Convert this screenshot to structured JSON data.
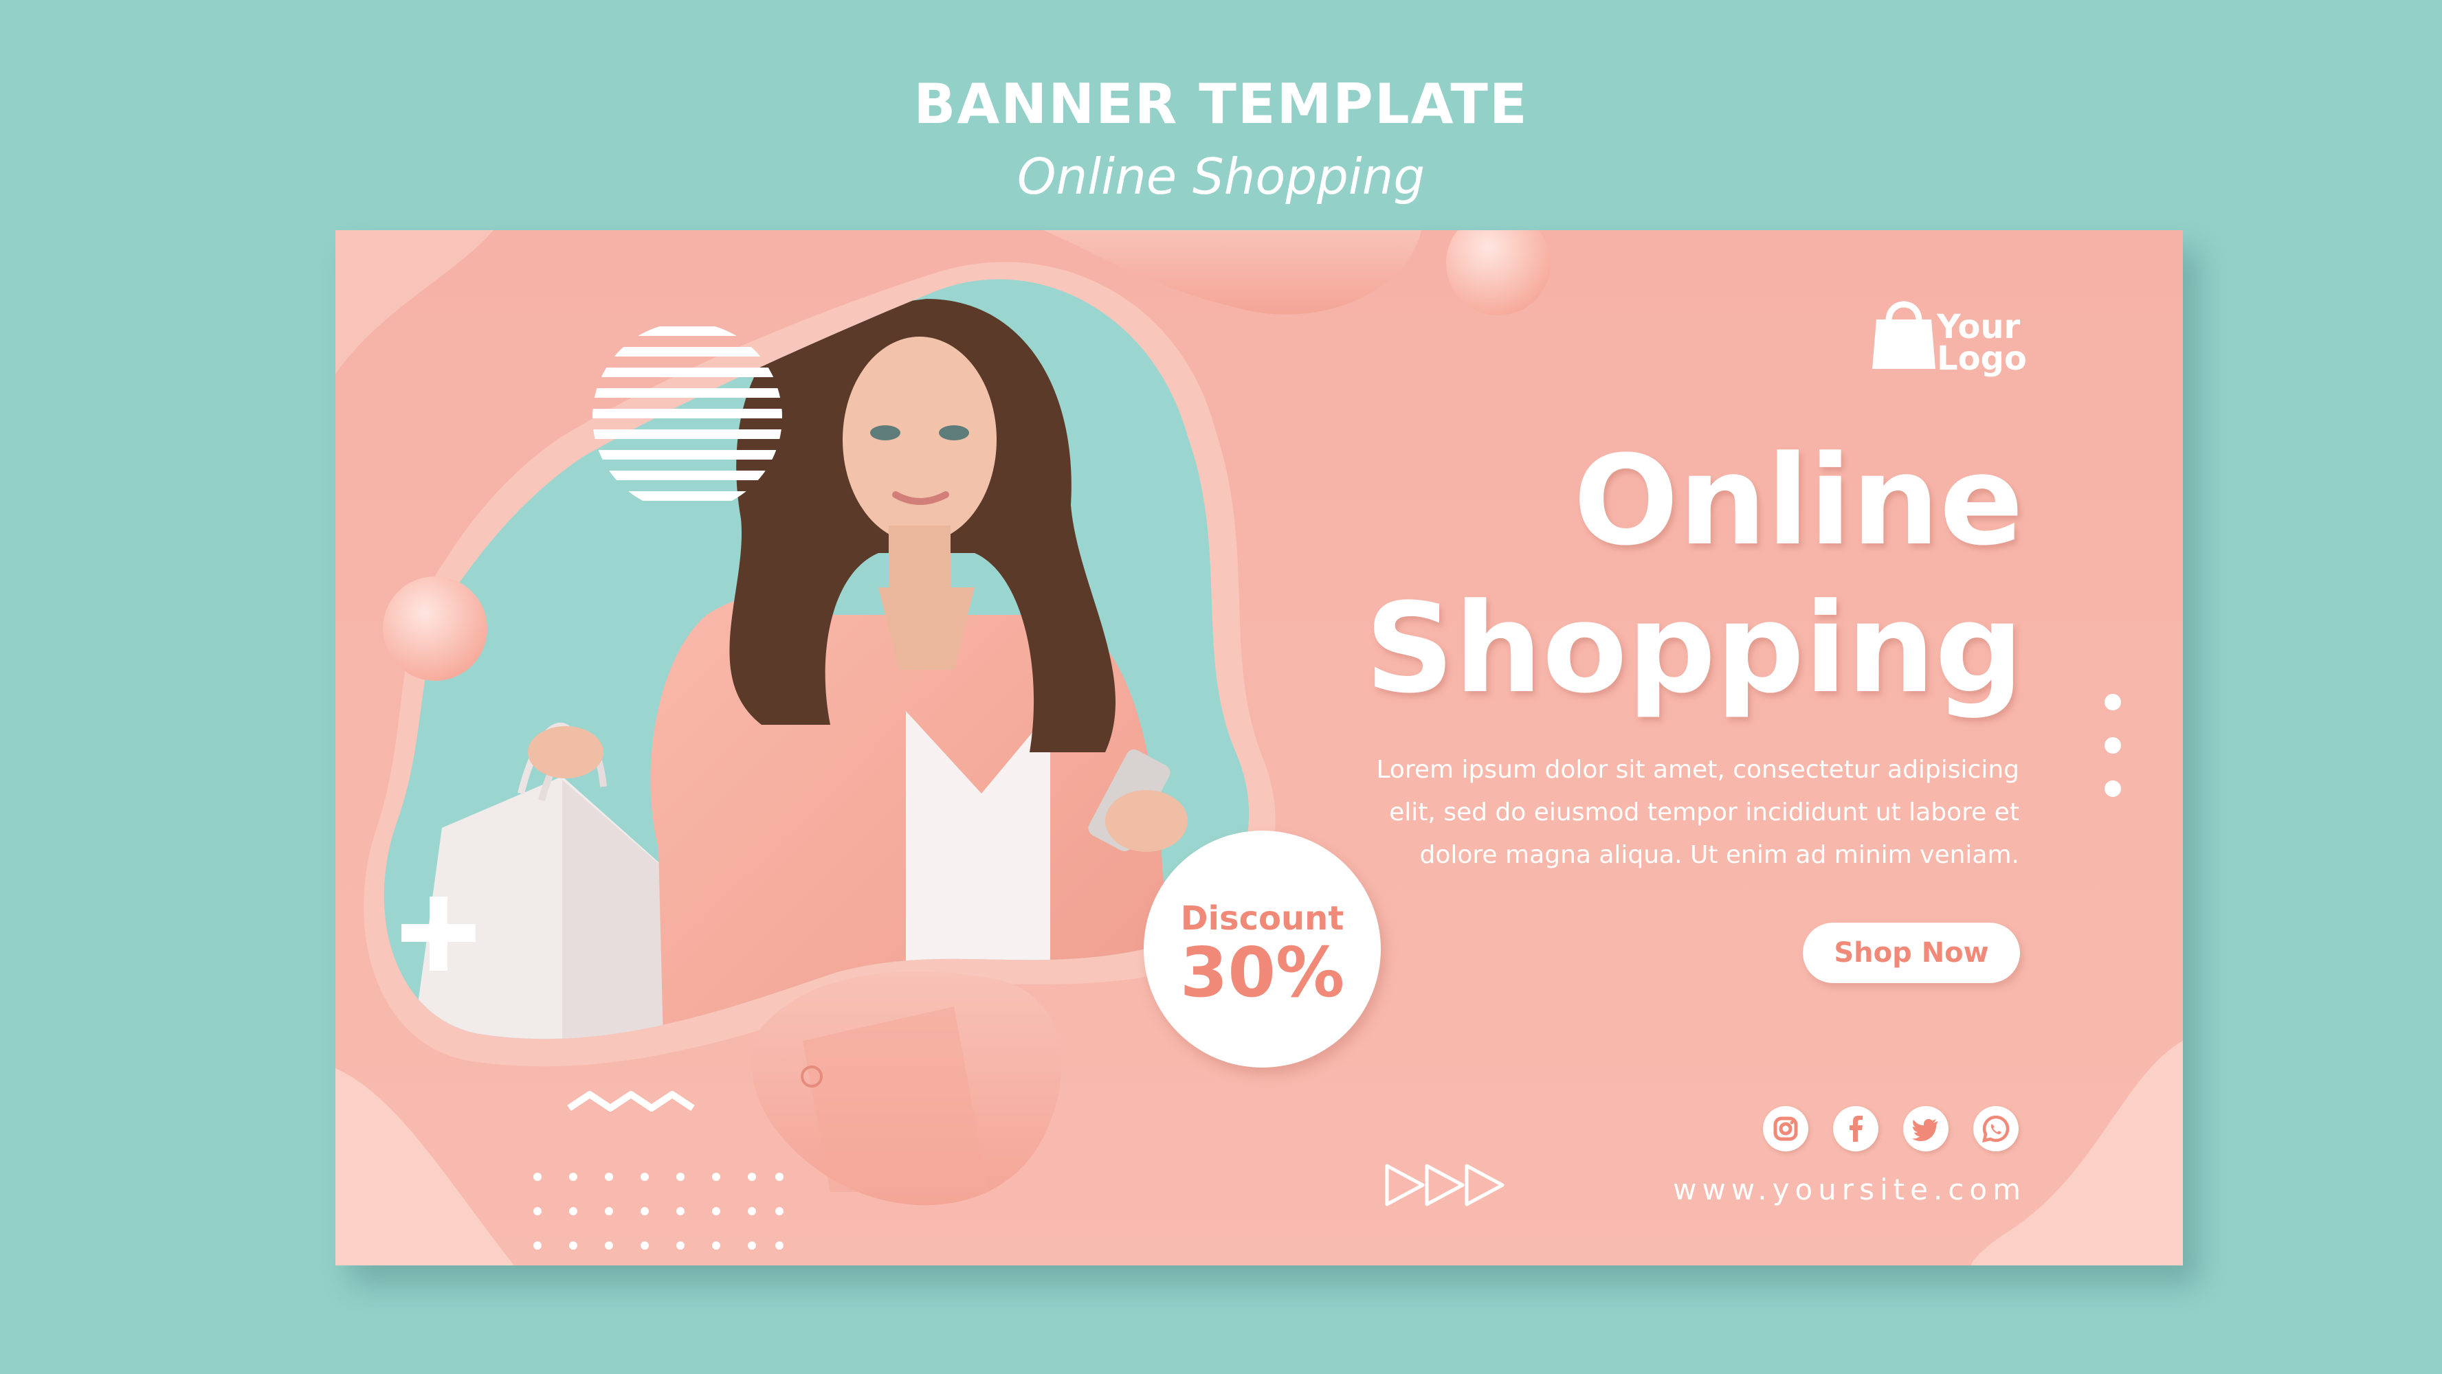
{
  "header": {
    "title": "BANNER TEMPLATE",
    "subtitle": "Online Shopping"
  },
  "banner": {
    "logo": {
      "line1": "Your",
      "line2": "Logo",
      "icon": "shopping-bag-icon"
    },
    "headline_line1": "Online",
    "headline_line2": "Shopping",
    "body": "Lorem ipsum dolor sit amet, consectetur adipisicing elit, sed do eiusmod tempor incididunt ut labore et dolore magna aliqua. Ut enim ad minim veniam.",
    "cta_label": "Shop Now",
    "discount_label": "Discount",
    "discount_value": "30%",
    "social_icons": [
      "instagram-icon",
      "facebook-icon",
      "twitter-icon",
      "whatsapp-icon"
    ],
    "website": "www.yoursite.com"
  },
  "colors": {
    "background": "#92d0c8",
    "banner": "#f6b2a6",
    "accent": "#f08978",
    "text": "#ffffff"
  }
}
